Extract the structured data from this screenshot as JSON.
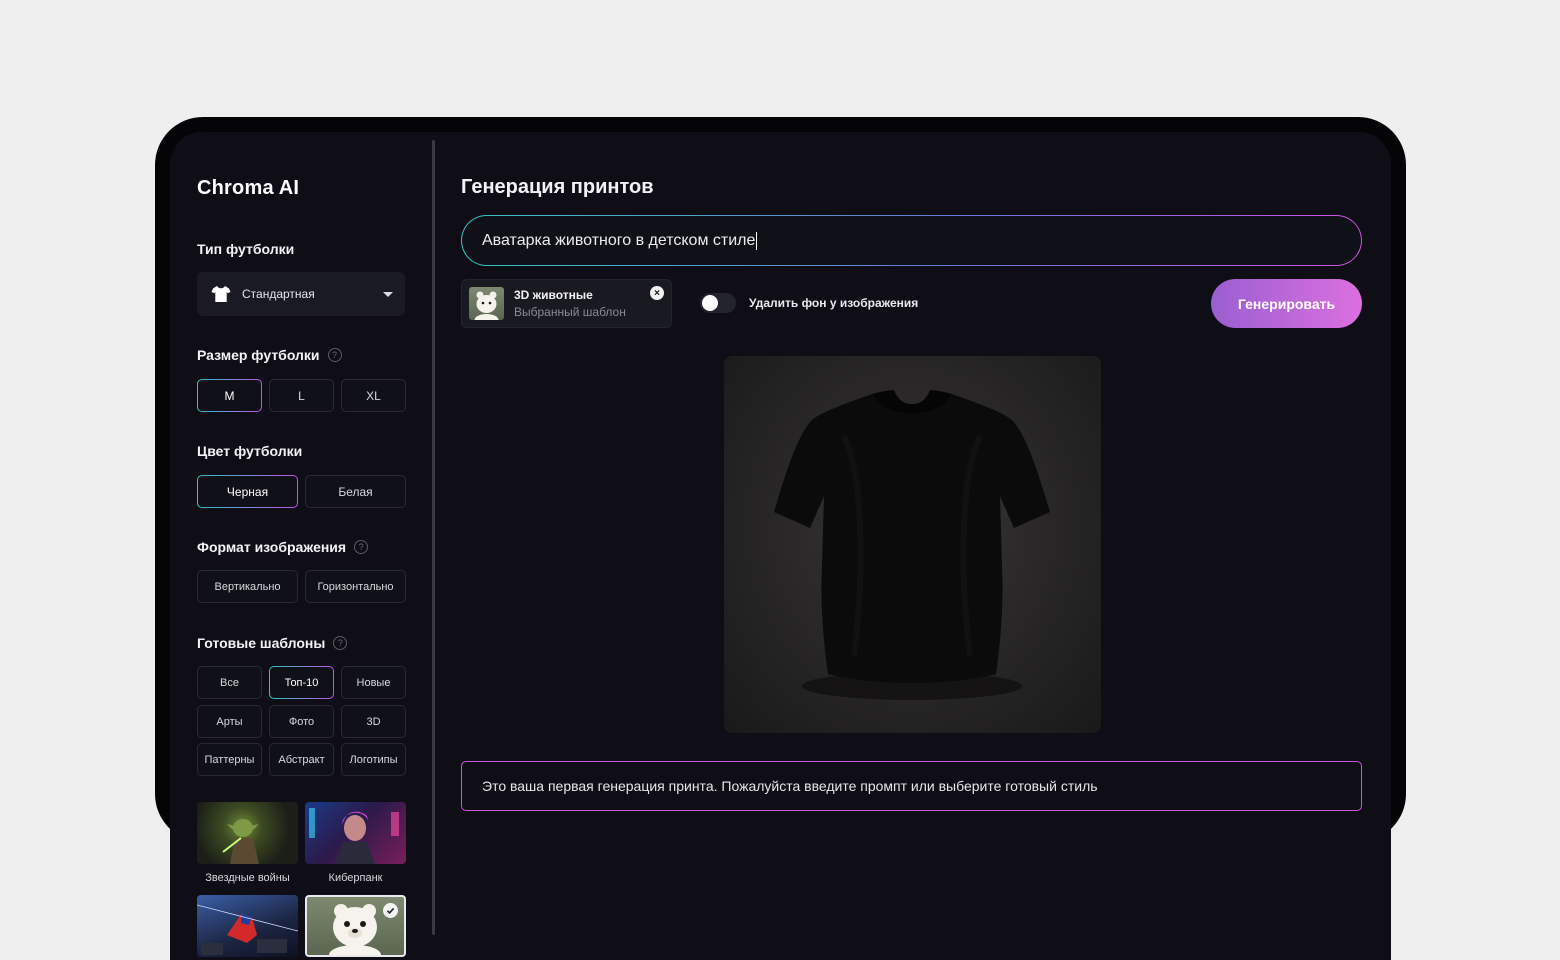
{
  "app": {
    "logo": "Chroma AI"
  },
  "sidebar": {
    "tshirt_type": {
      "title": "Тип футболки",
      "selected": "Стандартная",
      "icon": "tshirt-icon"
    },
    "tshirt_size": {
      "title": "Размер футболки",
      "help_icon": "?",
      "options": [
        "M",
        "L",
        "XL"
      ],
      "selected": "M"
    },
    "tshirt_color": {
      "title": "Цвет футболки",
      "options": [
        "Черная",
        "Белая"
      ],
      "selected": "Черная"
    },
    "image_format": {
      "title": "Формат изображения",
      "help_icon": "?",
      "options": [
        "Вертикально",
        "Горизонтально"
      ],
      "selected": "Вертикально"
    },
    "templates": {
      "title": "Готовые шаблоны",
      "help_icon": "?",
      "filters": [
        "Все",
        "Топ-10",
        "Новые",
        "Арты",
        "Фото",
        "3D",
        "Паттерны",
        "Абстракт",
        "Логотипы"
      ],
      "selected_filter": "Топ-10",
      "items": [
        {
          "label": "Звездные войны"
        },
        {
          "label": "Киберпанк"
        },
        {
          "label": ""
        },
        {
          "label": ""
        }
      ]
    }
  },
  "main": {
    "title": "Генерация принтов",
    "prompt_value": "Аватарка животного в детском стиле",
    "selected_template": {
      "name": "3D животные",
      "caption": "Выбранный шаблон",
      "remove_icon": "×"
    },
    "remove_bg_label": "Удалить фон у изображения",
    "remove_bg_enabled": false,
    "generate_label": "Генерировать",
    "notice": "Это ваша первая генерация принта. Пожалуйста введите промпт или выберите готовый стиль"
  },
  "colors": {
    "accent_cyan": "#2ec6c8",
    "accent_pink": "#c650e6",
    "background": "#0f0e17"
  }
}
